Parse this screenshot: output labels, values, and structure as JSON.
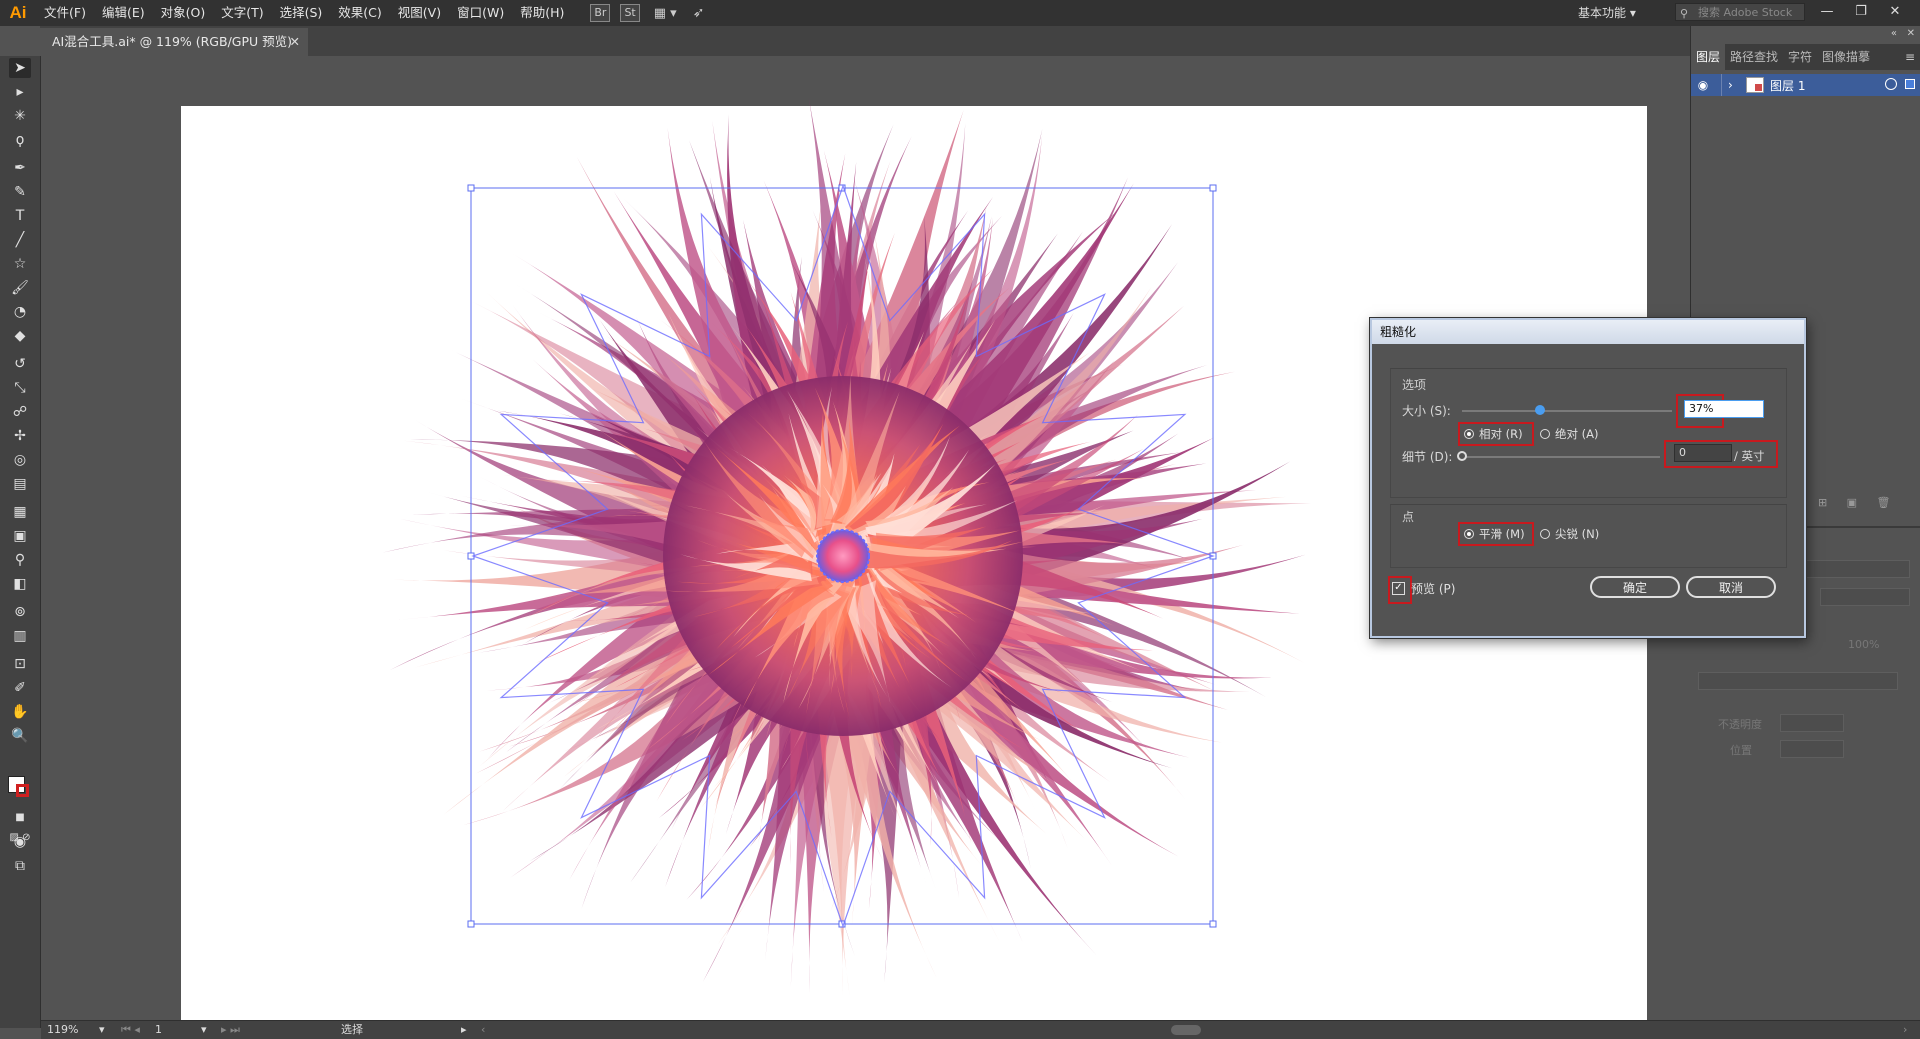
{
  "app": {
    "logo": "Ai",
    "menu": [
      "文件(F)",
      "编辑(E)",
      "对象(O)",
      "文字(T)",
      "选择(S)",
      "效果(C)",
      "视图(V)",
      "窗口(W)",
      "帮助(H)"
    ],
    "bridge_label": "Br",
    "stock_label": "St",
    "workspace": "基本功能",
    "search_placeholder": "搜索 Adobe Stock",
    "window_buttons": [
      "—",
      "❐",
      "✕"
    ]
  },
  "document": {
    "tab_title": "AI混合工具.ai* @ 119% (RGB/GPU 预览)",
    "close_glyph": "✕"
  },
  "panels": {
    "tabs": [
      "图层",
      "路径查找",
      "字符",
      "图像描摹"
    ],
    "active_tab": "图层",
    "layer": {
      "name": "图层 1"
    },
    "lower": {
      "opacity_label": "不透明度",
      "position_label": "位置",
      "size_value": "100%"
    }
  },
  "dialog": {
    "title": "粗糙化",
    "options_group": "选项",
    "size_label": "大小 (S):",
    "size_value": "37%",
    "size_fraction": 0.37,
    "relative_label": "相对 (R)",
    "absolute_label": "绝对 (A)",
    "detail_label": "细节 (D):",
    "detail_value": "0",
    "detail_unit": "/ 英寸",
    "detail_fraction": 0,
    "points_group": "点",
    "smooth_label": "平滑 (M)",
    "sharp_label": "尖锐 (N)",
    "preview_label": "预览 (P)",
    "ok_label": "确定",
    "cancel_label": "取消"
  },
  "status": {
    "zoom": "119%",
    "artboard": "1",
    "tool": "选择"
  },
  "colors": {
    "accent_blue": "#4a9df0",
    "highlight_red": "#c8191e",
    "flower_center": "#ff6a50",
    "flower_outer": "#8a2c6a",
    "selection_blue": "#5b6cf0"
  }
}
